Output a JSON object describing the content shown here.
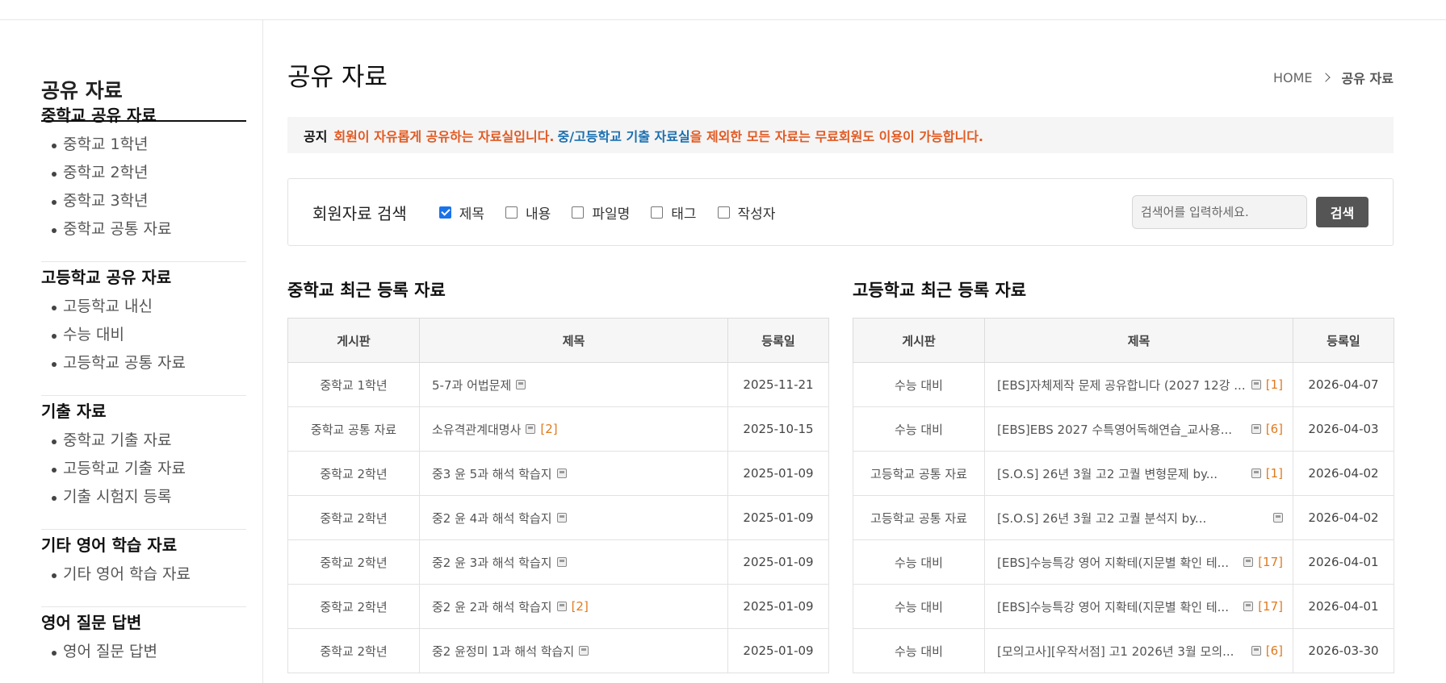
{
  "sidebar": {
    "title": "공유 자료",
    "groups": [
      {
        "heading": "중학교 공유 자료",
        "items": [
          "중학교 1학년",
          "중학교 2학년",
          "중학교 3학년",
          "중학교 공통 자료"
        ]
      },
      {
        "heading": "고등학교 공유 자료",
        "items": [
          "고등학교 내신",
          "수능 대비",
          "고등학교 공통 자료"
        ]
      },
      {
        "heading": "기출 자료",
        "items": [
          "중학교 기출 자료",
          "고등학교 기출 자료",
          "기출 시험지 등록"
        ]
      },
      {
        "heading": "기타 영어 학습 자료",
        "items": [
          "기타 영어 학습 자료"
        ]
      },
      {
        "heading": "영어 질문 답변",
        "items": [
          "영어 질문 답변"
        ]
      }
    ]
  },
  "header": {
    "title": "공유 자료",
    "breadcrumb_home": "HOME",
    "breadcrumb_current": "공유 자료"
  },
  "notice": {
    "label": "공지",
    "text1": "회원이 자유롭게 공유하는 자료실입니다.",
    "text2": "중/고등학교 기출 자료실",
    "text3": "을 제외한 모든 자료는 무료회원도 이용이 가능합니다."
  },
  "search": {
    "title": "회원자료 검색",
    "options": [
      {
        "label": "제목",
        "checked": true
      },
      {
        "label": "내용",
        "checked": false
      },
      {
        "label": "파일명",
        "checked": false
      },
      {
        "label": "태그",
        "checked": false
      },
      {
        "label": "작성자",
        "checked": false
      }
    ],
    "placeholder": "검색어를 입력하세요.",
    "button": "검색"
  },
  "middle": {
    "title": "중학교 최근 등록 자료",
    "headers": [
      "게시판",
      "제목",
      "등록일"
    ],
    "rows": [
      {
        "board": "중학교 1학년",
        "title": "5-7과 어법문제",
        "comments": "",
        "date": "2025-11-21"
      },
      {
        "board": "중학교 공통 자료",
        "title": "소유격관계대명사",
        "comments": "[2]",
        "date": "2025-10-15"
      },
      {
        "board": "중학교 2학년",
        "title": "중3 윤 5과 해석 학습지",
        "comments": "",
        "date": "2025-01-09"
      },
      {
        "board": "중학교 2학년",
        "title": "중2 윤 4과 해석 학습지",
        "comments": "",
        "date": "2025-01-09"
      },
      {
        "board": "중학교 2학년",
        "title": "중2 윤 3과 해석 학습지",
        "comments": "",
        "date": "2025-01-09"
      },
      {
        "board": "중학교 2학년",
        "title": "중2 윤 2과 해석 학습지",
        "comments": "[2]",
        "date": "2025-01-09"
      },
      {
        "board": "중학교 2학년",
        "title": "중2 윤정미 1과 해석 학습지",
        "comments": "",
        "date": "2025-01-09"
      }
    ]
  },
  "high": {
    "title": "고등학교 최근 등록 자료",
    "headers": [
      "게시판",
      "제목",
      "등록일"
    ],
    "rows": [
      {
        "board": "수능 대비",
        "title": "[EBS]자체제작 문제 공유합니다 (2027 12강 ...",
        "comments": "[1]",
        "date": "2026-04-07"
      },
      {
        "board": "수능 대비",
        "title": "[EBS]EBS 2027 수특영어독해연습_교사용...",
        "comments": "[6]",
        "date": "2026-04-03"
      },
      {
        "board": "고등학교 공통 자료",
        "title": "[S.O.S] 26년 3월 고2 고퀄 변형문제 by...",
        "comments": "[1]",
        "date": "2026-04-02"
      },
      {
        "board": "고등학교 공통 자료",
        "title": "[S.O.S] 26년 3월 고2 고퀄 분석지 by...",
        "comments": "",
        "date": "2026-04-02"
      },
      {
        "board": "수능 대비",
        "title": "[EBS]수능특강 영어 지확테(지문별 확인 테...",
        "comments": "[17]",
        "date": "2026-04-01"
      },
      {
        "board": "수능 대비",
        "title": "[EBS]수능특강 영어 지확테(지문별 확인 테...",
        "comments": "[17]",
        "date": "2026-04-01"
      },
      {
        "board": "수능 대비",
        "title": "[모의고사][우작서점] 고1 2026년 3월 모의...",
        "comments": "[6]",
        "date": "2026-03-30"
      }
    ]
  }
}
